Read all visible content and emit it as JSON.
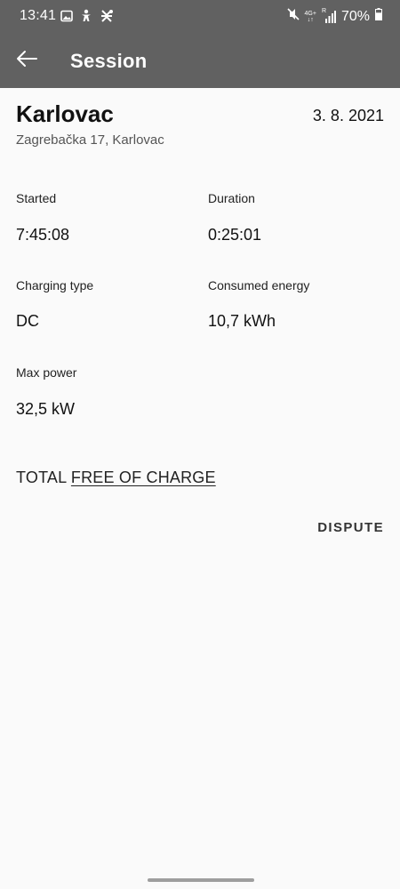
{
  "status_bar": {
    "time": "13:41",
    "network_label": "4G+",
    "roaming_label": "R",
    "battery_percent": "70%",
    "battery_level": 0.7,
    "left_icons": [
      "gallery-icon",
      "accessibility-icon",
      "app-notification-icon"
    ],
    "right_icons": [
      "mute-icon",
      "signal-icon",
      "battery-icon"
    ]
  },
  "app_bar": {
    "title": "Session",
    "back_icon": "arrow-left-icon"
  },
  "session": {
    "location_name": "Karlovac",
    "date": "3. 8. 2021",
    "address": "Zagrebačka 17, Karlovac",
    "started_label": "Started",
    "started_value": "7:45:08",
    "duration_label": "Duration",
    "duration_value": "0:25:01",
    "charging_type_label": "Charging type",
    "charging_type_value": "DC",
    "consumed_energy_label": "Consumed energy",
    "consumed_energy_value": "10,7 kWh",
    "max_power_label": "Max power",
    "max_power_value": "32,5 kW",
    "total_label": "TOTAL",
    "total_value": "FREE OF CHARGE"
  },
  "actions": {
    "dispute_label": "DISPUTE"
  },
  "colors": {
    "app_bar": "#616161",
    "background": "#fafafa",
    "text": "#1c1c1c"
  }
}
